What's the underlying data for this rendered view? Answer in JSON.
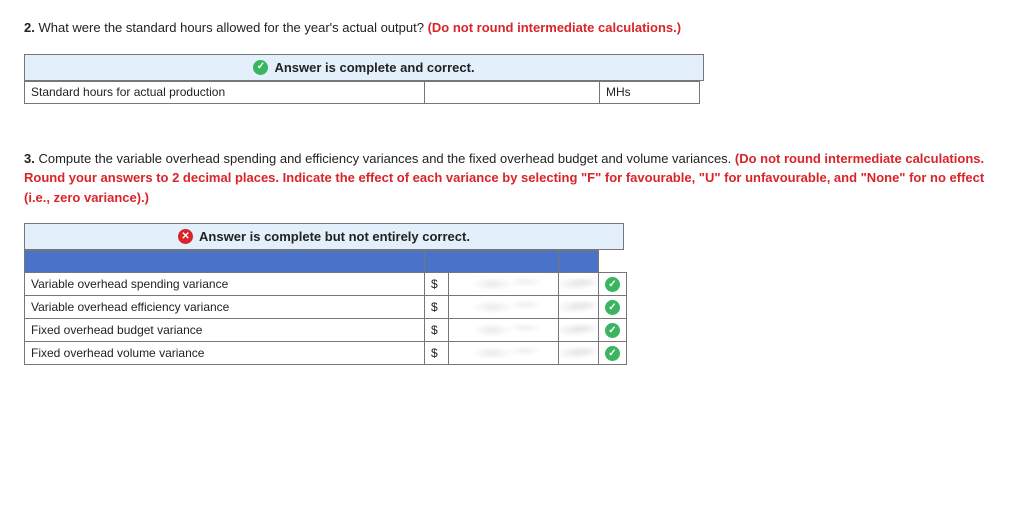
{
  "q2": {
    "num": "2.",
    "text": "What were the standard hours allowed for the year's actual output? ",
    "note": "(Do not round intermediate calculations.)",
    "status": "Answer is complete and correct.",
    "row_label": "Standard hours for actual production",
    "row_value": "",
    "row_unit": "MHs"
  },
  "q3": {
    "num": "3.",
    "text": "Compute the variable overhead spending and efficiency variances and the fixed overhead budget and volume variances. ",
    "note": "(Do not round intermediate calculations. Round your answers to 2 decimal places. Indicate the effect of each variance by selecting \"F\" for favourable, \"U\" for unfavourable, and \"None\" for no effect (i.e., zero variance).)",
    "status": "Answer is complete but not entirely correct.",
    "rows": [
      {
        "label": "Variable overhead spending variance",
        "currency": "$",
        "value": "",
        "flag": ""
      },
      {
        "label": "Variable overhead efficiency variance",
        "currency": "$",
        "value": "",
        "flag": ""
      },
      {
        "label": "Fixed overhead budget variance",
        "currency": "$",
        "value": "",
        "flag": ""
      },
      {
        "label": "Fixed overhead volume variance",
        "currency": "$",
        "value": "",
        "flag": ""
      }
    ]
  },
  "icons": {
    "check": "✓",
    "cross": "✕"
  }
}
